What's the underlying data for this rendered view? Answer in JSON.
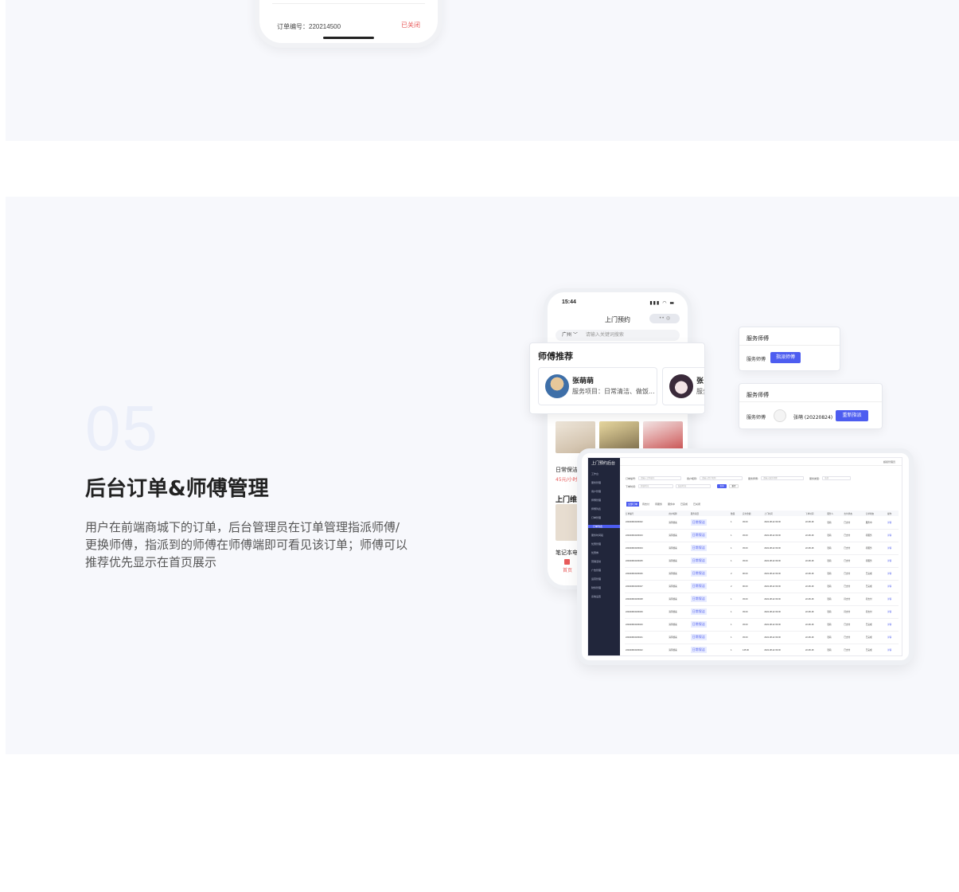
{
  "top_phone": {
    "order_no": "订单编号：220214500",
    "status": "已关闭"
  },
  "section": {
    "number": "05",
    "title": "后台订单&师傅管理",
    "description": "用户在前端商城下的订单，后台管理员在订单管理指派师傅/更换师傅，指派到的师傅在师傅端即可看见该订单；师傅可以推荐优先显示在首页展示"
  },
  "phone": {
    "time": "15:44",
    "status_icons": "▮▮▮ ◠ ▬",
    "title": "上门预约",
    "capsule": "•• ◎",
    "city": "广州 ﹀",
    "search_placeholder": "请输入关键词搜索",
    "item1_name": "日常保洁",
    "item1_price": "45元/小时",
    "section2": "上门维修",
    "item2_name": "笔记本电脑",
    "tab_home": "首页"
  },
  "recommend": {
    "title": "师傅推荐",
    "masters": [
      {
        "name": "张萌萌",
        "service": "服务项目：日常清洁、做饭..."
      },
      {
        "name": "张",
        "service": "服务"
      }
    ]
  },
  "assign_card": {
    "header": "服务师傅",
    "label": "服务师傅",
    "button": "指派师傅"
  },
  "reassign_card": {
    "header": "服务师傅",
    "label": "服务师傅",
    "master": "张萌 (20220824)",
    "button": "重新指派"
  },
  "admin": {
    "brand": "上门预约后台",
    "user": "超级管理员",
    "nav": [
      "工作台",
      "服务管理",
      "用户管理",
      "师傅管理",
      "师傅列表",
      "订单管理",
      "订单列表",
      "服务时间段",
      "优惠管理",
      "优惠券",
      "营销活动",
      "广告管理",
      "运营管理",
      "财务管理",
      "系统设置"
    ],
    "filters": {
      "order_no_label": "订单编号:",
      "order_no_ph": "请输入订单编号",
      "user_label": "用户昵称:",
      "user_ph": "请输入用户昵称",
      "master_label": "服务师傅:",
      "master_ph": "请输入服务师傅",
      "type_label": "服务类型:",
      "type_value": "全部",
      "time_label": "下单时间:",
      "start_ph": "开始时间",
      "end_ph": "结束时间",
      "search": "查询",
      "reset": "重置"
    },
    "tabs": [
      "全部订单",
      "待支付",
      "待服务",
      "服务中",
      "已完成",
      "已关闭"
    ],
    "columns": [
      "订单编号",
      "用户昵称",
      "服务项目",
      "数量",
      "实付金额",
      "上门时间",
      "下单时间",
      "服务人",
      "支付状态",
      "订单状态",
      "操作"
    ],
    "rows": [
      [
        "220220824184932",
        "清风徐来",
        "日常保洁",
        "1",
        "45.00",
        "2022-08-22 09:00",
        "22-08-18",
        "张萌",
        "已支付",
        "服务中",
        "详情"
      ],
      [
        "220220824184933",
        "清风徐来",
        "日常保洁",
        "1",
        "45.00",
        "2022-08-22 09:00",
        "22-08-18",
        "张萌",
        "已支付",
        "待服务",
        "详情"
      ],
      [
        "220220824184934",
        "清风徐来",
        "日常保洁",
        "1",
        "45.00",
        "2022-08-22 09:00",
        "22-08-18",
        "张萌",
        "已支付",
        "待服务",
        "详情"
      ],
      [
        "220220824184935",
        "清风徐来",
        "日常保洁",
        "1",
        "45.00",
        "2022-08-22 09:00",
        "22-08-18",
        "张萌",
        "已支付",
        "待服务",
        "详情"
      ],
      [
        "220220824184936",
        "清风徐来",
        "日常保洁",
        "2",
        "90.00",
        "2022-08-22 09:00",
        "22-08-18",
        "张萌",
        "已支付",
        "已完成",
        "详情"
      ],
      [
        "220220824184937",
        "清风徐来",
        "日常保洁",
        "2",
        "90.00",
        "2022-08-22 09:00",
        "22-08-18",
        "张萌",
        "已支付",
        "已完成",
        "详情"
      ],
      [
        "220220824184938",
        "清风徐来",
        "日常保洁",
        "1",
        "45.00",
        "2022-08-22 09:00",
        "22-08-18",
        "张萌",
        "待支付",
        "待支付",
        "详情"
      ],
      [
        "220220824184939",
        "清风徐来",
        "日常保洁",
        "1",
        "45.00",
        "2022-08-22 09:00",
        "22-08-18",
        "张萌",
        "待支付",
        "待支付",
        "详情"
      ],
      [
        "220220824184940",
        "清风徐来",
        "日常保洁",
        "1",
        "45.00",
        "2022-08-22 09:00",
        "22-08-18",
        "张萌",
        "已支付",
        "已完成",
        "详情"
      ],
      [
        "220220824184941",
        "清风徐来",
        "日常保洁",
        "1",
        "45.00",
        "2022-08-22 09:00",
        "22-08-18",
        "张萌",
        "已支付",
        "已完成",
        "详情"
      ],
      [
        "220220824184942",
        "清风徐来",
        "日常保洁",
        "1",
        "145.00",
        "2022-08-22 09:00",
        "22-08-18",
        "张萌",
        "已支付",
        "已完成",
        "详情"
      ]
    ]
  },
  "colors": {
    "accent": "#4d5df0",
    "sidebar": "#21263b",
    "price": "#e85b5b",
    "band": "#f7f8fc"
  }
}
